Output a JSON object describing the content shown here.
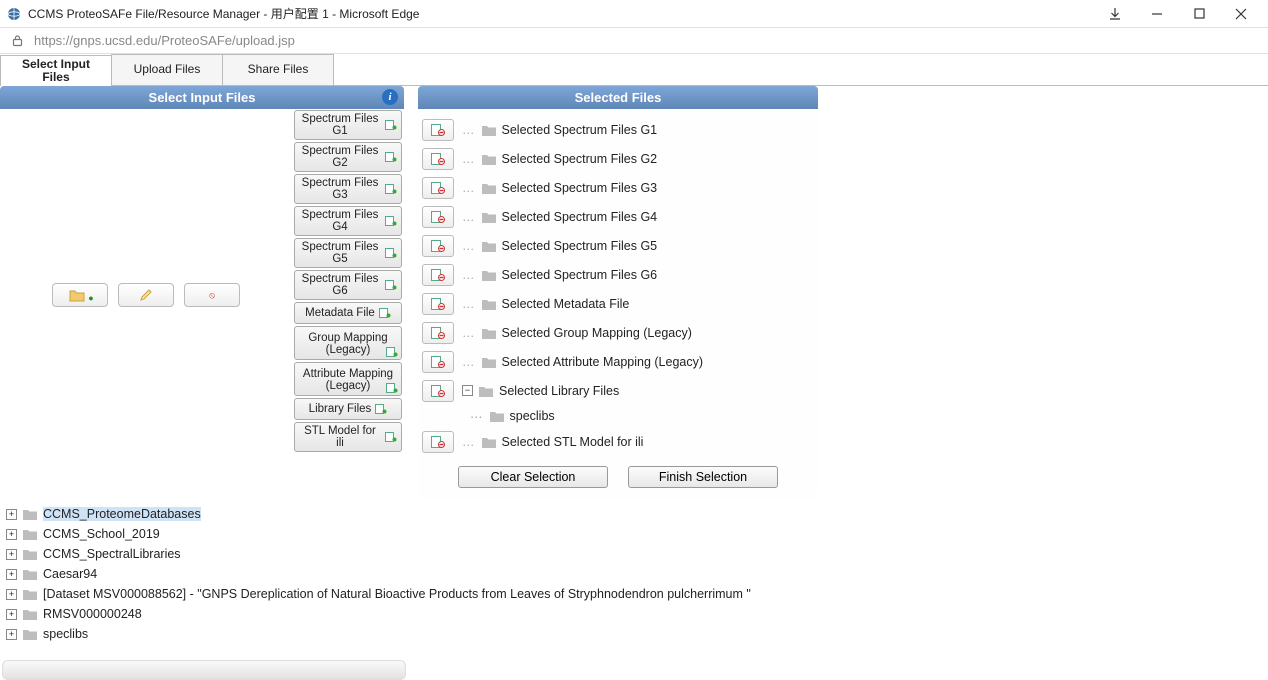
{
  "window": {
    "title": "CCMS ProteoSAFe File/Resource Manager - 用户配置 1 - Microsoft Edge",
    "url_display": "https://gnps.ucsd.edu/ProteoSAFe/upload.jsp"
  },
  "tabs": [
    {
      "label": "Select Input Files",
      "active": true
    },
    {
      "label": "Upload Files",
      "active": false
    },
    {
      "label": "Share Files",
      "active": false
    }
  ],
  "left_panel": {
    "title": "Select Input Files",
    "categories": [
      "Spectrum Files G1",
      "Spectrum Files G2",
      "Spectrum Files G3",
      "Spectrum Files G4",
      "Spectrum Files G5",
      "Spectrum Files G6",
      "Metadata File",
      "Group Mapping (Legacy)",
      "Attribute Mapping (Legacy)",
      "Library Files",
      "STL Model for ili"
    ]
  },
  "right_panel": {
    "title": "Selected Files",
    "rows": [
      {
        "label": "Selected Spectrum Files G1"
      },
      {
        "label": "Selected Spectrum Files G2"
      },
      {
        "label": "Selected Spectrum Files G3"
      },
      {
        "label": "Selected Spectrum Files G4"
      },
      {
        "label": "Selected Spectrum Files G5"
      },
      {
        "label": "Selected Spectrum Files G6"
      },
      {
        "label": "Selected Metadata File"
      },
      {
        "label": "Selected Group Mapping (Legacy)"
      },
      {
        "label": "Selected Attribute Mapping (Legacy)"
      },
      {
        "label": "Selected Library Files",
        "expanded": true,
        "children": [
          "speclibs"
        ]
      },
      {
        "label": "Selected STL Model for ili"
      }
    ],
    "buttons": {
      "clear": "Clear Selection",
      "finish": "Finish Selection"
    }
  },
  "bottom_tree": [
    {
      "name": "CCMS_ProteomeDatabases",
      "selected": true
    },
    {
      "name": "CCMS_School_2019"
    },
    {
      "name": "CCMS_SpectralLibraries"
    },
    {
      "name": "Caesar94"
    },
    {
      "name": "[Dataset MSV000088562] - \"GNPS Dereplication of Natural Bioactive Products from Leaves of Stryphnodendron pulcherrimum \""
    },
    {
      "name": "RMSV000000248"
    },
    {
      "name": "speclibs"
    }
  ]
}
